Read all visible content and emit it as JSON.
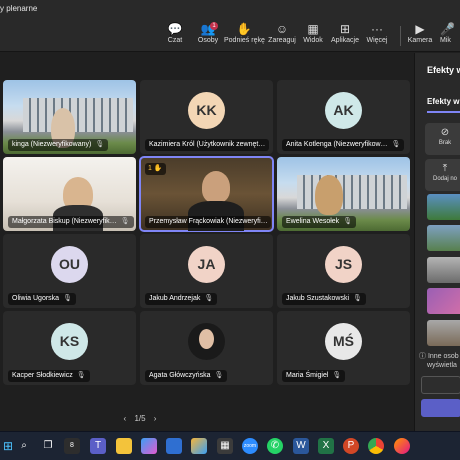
{
  "window": {
    "title": "y plenarne"
  },
  "toolbar": {
    "items": [
      {
        "label": "Czat",
        "icon": "chat-icon"
      },
      {
        "label": "Osoby",
        "icon": "people-icon",
        "badge": "1"
      },
      {
        "label": "Podnieś rękę",
        "icon": "raise-hand-icon"
      },
      {
        "label": "Zareaguj",
        "icon": "react-icon"
      },
      {
        "label": "Widok",
        "icon": "view-icon"
      },
      {
        "label": "Aplikacje",
        "icon": "apps-icon"
      },
      {
        "label": "Więcej",
        "icon": "more-icon"
      },
      {
        "label": "Kamera",
        "icon": "camera-icon"
      },
      {
        "label": "Mik",
        "icon": "mic-icon"
      }
    ]
  },
  "participants": [
    {
      "name": "kinga (Niezweryfikowany)",
      "video": "building"
    },
    {
      "name": "Kazimiera Król (Użytkownik zewnęt…",
      "initials": "KK",
      "avatar_color": "#f3d6b5"
    },
    {
      "name": "Anita Kotlenga (Niezweryfikow…",
      "initials": "AK",
      "avatar_color": "#cfe8e8"
    },
    {
      "name": "Małgorzata Biskup (Niezweryfik…",
      "video": "room"
    },
    {
      "name": "Przemysław Frąckowiak (Niezweryfi…",
      "video": "office",
      "active": true,
      "hand": "1"
    },
    {
      "name": "Ewelina Wesołek",
      "video": "building2"
    },
    {
      "name": "Oliwia Ugorska",
      "initials": "OU",
      "avatar_color": "#dcd8ee"
    },
    {
      "name": "Jakub Andrzejak",
      "initials": "JA",
      "avatar_color": "#f1d3c7"
    },
    {
      "name": "Jakub Szustakowski",
      "initials": "JS",
      "avatar_color": "#f1d3c7"
    },
    {
      "name": "Kacper Słodkiewicz",
      "initials": "KS",
      "avatar_color": "#cfe8e8"
    },
    {
      "name": "Agata Główczyńska",
      "video": "portrait"
    },
    {
      "name": "Maria Śmigiel",
      "initials": "MŚ",
      "avatar_color": "#e8e8e8"
    }
  ],
  "pager": {
    "text": "1/5",
    "prev": "‹",
    "next": "›"
  },
  "panel": {
    "title": "Efekty w",
    "subtitle": "Efekty wi",
    "none_label": "Brak",
    "add_label": "Dodaj no",
    "note_line1": "Inne osob",
    "note_line2": "wyświetla",
    "backgrounds": [
      "#5a8fc2",
      "#7ea0c2",
      "#b4b4b4",
      "#9a5fb4",
      "#a8a8a8"
    ]
  },
  "taskbar": {
    "apps": [
      "windows-icon",
      "search-icon",
      "taskview-icon",
      "teams-icon",
      "explorer-icon",
      "copilot-icon",
      "store-icon",
      "photos-icon",
      "calculator-icon",
      "zoom-icon",
      "whatsapp-icon",
      "word-icon",
      "excel-icon",
      "powerpoint-icon",
      "chrome-icon",
      "firefox-icon"
    ]
  }
}
